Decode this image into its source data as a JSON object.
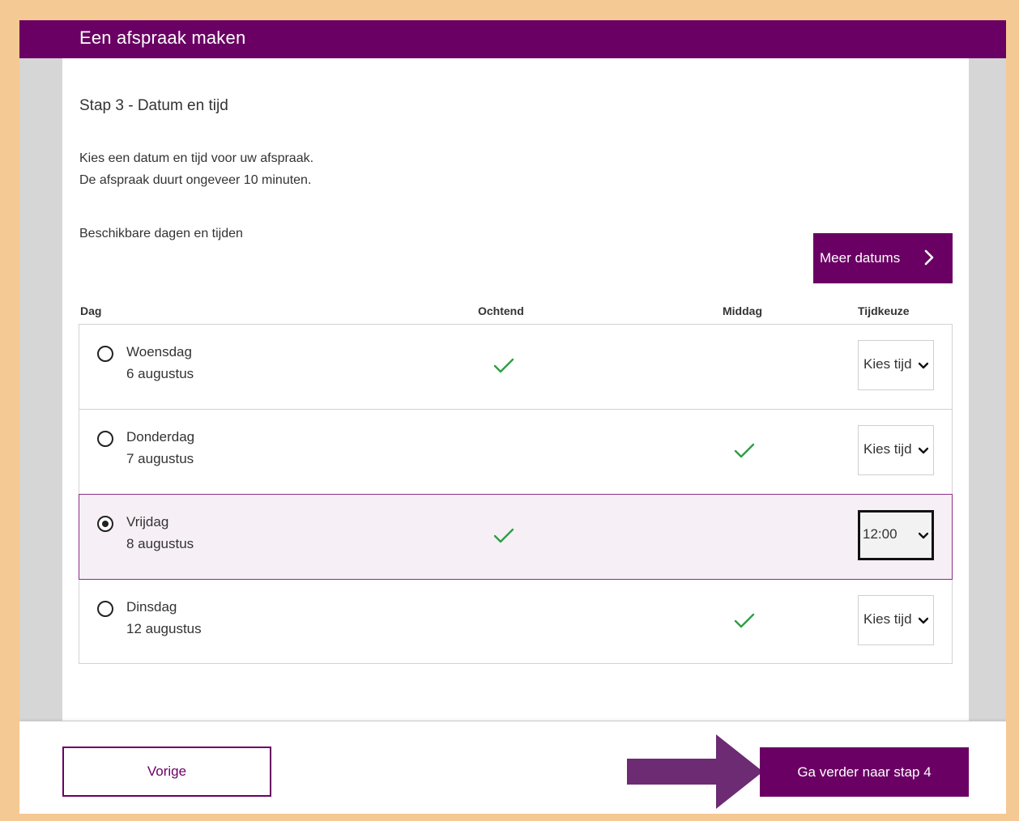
{
  "header": {
    "title": "Een afspraak maken"
  },
  "step": {
    "title": "Stap 3 - Datum en tijd",
    "intro_line1": "Kies een datum en tijd voor uw afspraak.",
    "intro_line2": "De afspraak duurt ongeveer 10 minuten.",
    "available_label": "Beschikbare dagen en tijden"
  },
  "more_dates_label": "Meer datums",
  "columns": {
    "dag": "Dag",
    "ochtend": "Ochtend",
    "middag": "Middag",
    "tijdkeuze": "Tijdkeuze"
  },
  "rows": [
    {
      "day": "Woensdag",
      "date": "6 augustus",
      "ochtend": true,
      "middag": false,
      "time": "Kies tijd",
      "selected": false
    },
    {
      "day": "Donderdag",
      "date": "7 augustus",
      "ochtend": false,
      "middag": true,
      "time": "Kies tijd",
      "selected": false
    },
    {
      "day": "Vrijdag",
      "date": "8 augustus",
      "ochtend": true,
      "middag": false,
      "time": "12:00",
      "selected": true
    },
    {
      "day": "Dinsdag",
      "date": "12 augustus",
      "ochtend": false,
      "middag": true,
      "time": "Kies tijd",
      "selected": false
    }
  ],
  "footer": {
    "prev_label": "Vorige",
    "next_label": "Ga verder naar stap 4"
  },
  "colors": {
    "brand": "#6a0063",
    "check": "#2e9e47",
    "annotation_arrow": "#6c2b73",
    "background": "#f5c994"
  },
  "icons": {
    "chevron": "chevron-right-icon",
    "check": "checkmark-icon",
    "dropdown": "chevron-down-icon",
    "annotation": "arrow-right-icon"
  }
}
